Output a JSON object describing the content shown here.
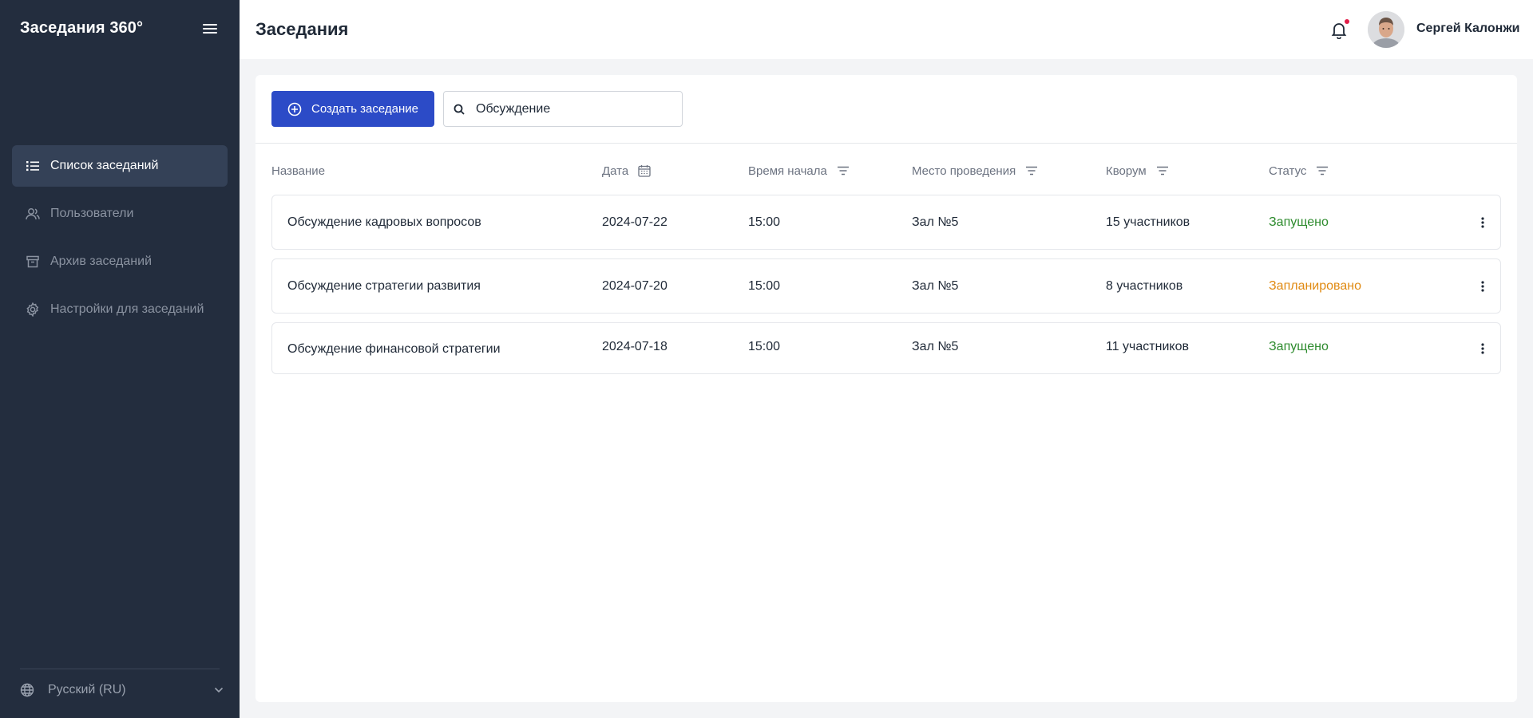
{
  "sidebar": {
    "brand": "Заседания 360°",
    "items": [
      {
        "label": "Список заседаний",
        "icon": "list-icon",
        "active": true
      },
      {
        "label": "Пользователи",
        "icon": "users-icon",
        "active": false
      },
      {
        "label": "Архив заседаний",
        "icon": "archive-icon",
        "active": false
      },
      {
        "label": "Настройки для заседаний",
        "icon": "gear-icon",
        "active": false
      }
    ],
    "language": "Русский (RU)"
  },
  "header": {
    "title": "Заседания",
    "user_name": "Сергей Калонжи"
  },
  "toolbar": {
    "create_label": "Создать заседание",
    "search_value": "Обсуждение"
  },
  "table": {
    "columns": [
      "Название",
      "Дата",
      "Время начала",
      "Место проведения",
      "Кворум",
      "Статус"
    ],
    "rows": [
      {
        "name": "Обсуждение кадровых вопросов",
        "date": "2024-07-22",
        "time": "15:00",
        "place": "Зал №5",
        "quorum": "15 участников",
        "status": "Запущено",
        "status_kind": "running"
      },
      {
        "name": "Обсуждение стратегии развития",
        "date": "2024-07-20",
        "time": "15:00",
        "place": "Зал №5",
        "quorum": "8 участников",
        "status": "Запланировано",
        "status_kind": "planned"
      },
      {
        "name": "Обсуждение финансовой стратегии",
        "date": "2024-07-18",
        "time": "15:00",
        "place": "Зал №5",
        "quorum": "11 участников",
        "status": "Запущено",
        "status_kind": "running"
      }
    ]
  },
  "colors": {
    "sidebar_bg": "#232d3e",
    "sidebar_active": "#344157",
    "accent": "#2c4bc7",
    "status_running": "#2e8b2e",
    "status_planned": "#e08a12",
    "notification_dot": "#e11d48"
  }
}
